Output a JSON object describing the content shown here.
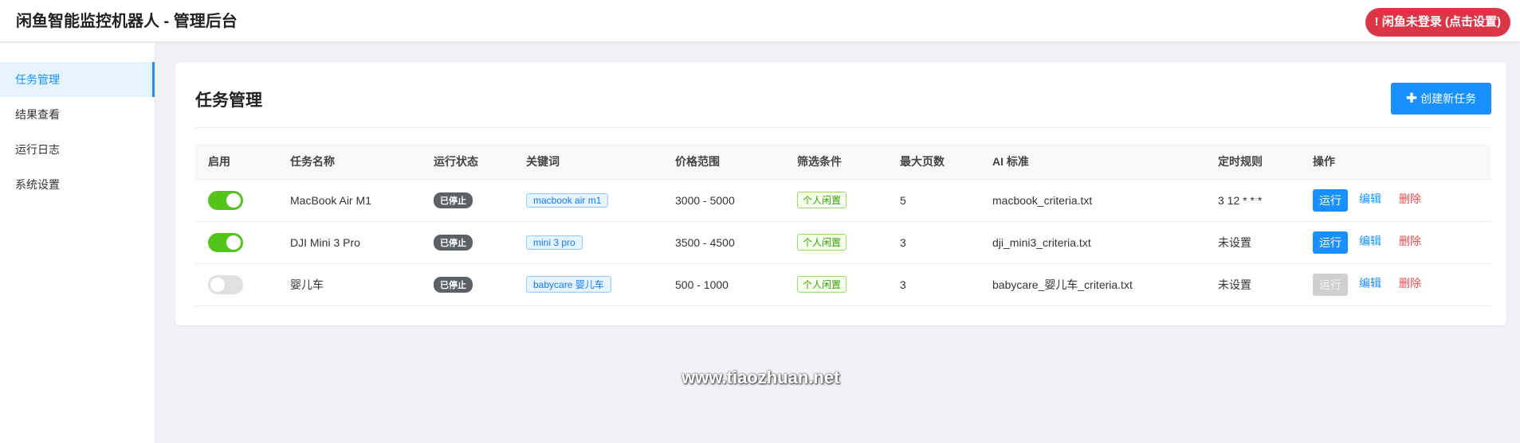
{
  "header": {
    "title": "闲鱼智能监控机器人 - 管理后台",
    "login_status": "! 闲鱼未登录 (点击设置)"
  },
  "sidebar": {
    "items": [
      {
        "label": "任务管理",
        "active": true
      },
      {
        "label": "结果查看",
        "active": false
      },
      {
        "label": "运行日志",
        "active": false
      },
      {
        "label": "系统设置",
        "active": false
      }
    ]
  },
  "main": {
    "title": "任务管理",
    "create_button": "创建新任务",
    "create_icon": "plus-icon",
    "columns": [
      "启用",
      "任务名称",
      "运行状态",
      "关键词",
      "价格范围",
      "筛选条件",
      "最大页数",
      "AI 标准",
      "定时规则",
      "操作"
    ],
    "tasks": [
      {
        "enabled": true,
        "name": "MacBook Air M1",
        "status": "已停止",
        "keyword": "macbook air m1",
        "price": "3000 - 5000",
        "filter": "个人闲置",
        "max_pages": "5",
        "ai_criteria": "macbook_criteria.txt",
        "schedule": "3 12 * * *",
        "run_label": "运行",
        "run_enabled": true,
        "edit_label": "编辑",
        "delete_label": "删除"
      },
      {
        "enabled": true,
        "name": "DJI Mini 3 Pro",
        "status": "已停止",
        "keyword": "mini 3 pro",
        "price": "3500 - 4500",
        "filter": "个人闲置",
        "max_pages": "3",
        "ai_criteria": "dji_mini3_criteria.txt",
        "schedule": "未设置",
        "run_label": "运行",
        "run_enabled": true,
        "edit_label": "编辑",
        "delete_label": "删除"
      },
      {
        "enabled": false,
        "name": "婴儿车",
        "status": "已停止",
        "keyword": "babycare 婴儿车",
        "price": "500 - 1000",
        "filter": "个人闲置",
        "max_pages": "3",
        "ai_criteria": "babycare_婴儿车_criteria.txt",
        "schedule": "未设置",
        "run_label": "运行",
        "run_enabled": false,
        "edit_label": "编辑",
        "delete_label": "删除"
      }
    ]
  },
  "watermark": "www.tiaozhuan.net",
  "colors": {
    "primary": "#1890ff",
    "danger": "#dc3545",
    "toggle_on": "#52c41a",
    "status_badge": "#5a6268"
  }
}
